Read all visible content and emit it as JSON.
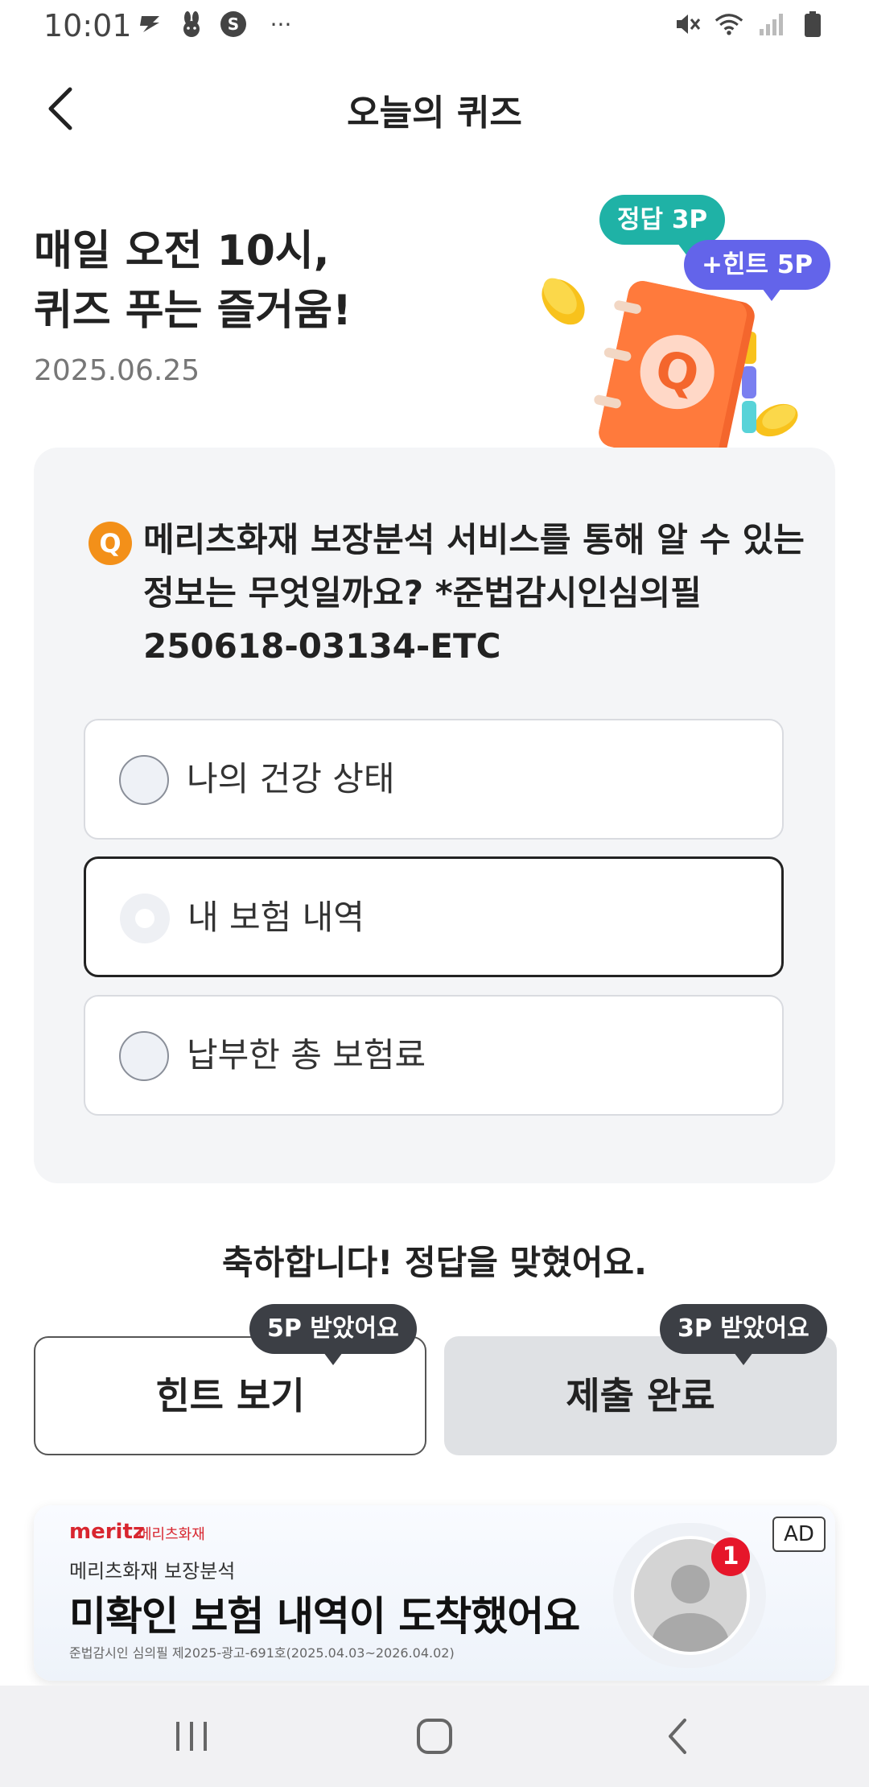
{
  "status_bar": {
    "time": "10:01",
    "left_icons": [
      "s-app-icon",
      "rabbit-app-icon",
      "s-circle-app-icon",
      "more-dots-icon"
    ],
    "more": "···",
    "right_icons": [
      "mute-icon",
      "wifi-icon",
      "signal-icon",
      "battery-icon"
    ]
  },
  "app_bar": {
    "title": "오늘의 퀴즈"
  },
  "hero": {
    "title_line1": "매일 오전 10시,",
    "title_line2": "퀴즈 푸는 즐거움!",
    "date": "2025.06.25",
    "bubble_answer": "정답 3P",
    "bubble_hint": "+힌트 5P",
    "illus_letter": "Q"
  },
  "quiz": {
    "badge": "Q",
    "question": "메리츠화재 보장분석 서비스를 통해 알 수 있는 정보는 무엇일까요? *준법감시인심의필 250618-03134-ETC",
    "options": [
      {
        "label": "나의 건강 상태",
        "selected": false
      },
      {
        "label": "내 보험 내역",
        "selected": true
      },
      {
        "label": "납부한 총 보험료",
        "selected": false
      }
    ]
  },
  "result": {
    "message": "축하합니다! 정답을 맞혔어요."
  },
  "actions": {
    "hint_label": "힌트 보기",
    "hint_tip": "5P 받았어요",
    "submit_label": "제출 완료",
    "submit_tip": "3P 받았어요"
  },
  "ad": {
    "brand": "meritz",
    "brand_kr": "메리츠화재",
    "sub": "메리츠화재 보장분석",
    "headline": "미확인 보험 내역이 도착했어요",
    "fine_print": "준법감시인 심의필 제2025-광고-691호(2025.04.03~2026.04.02)",
    "tag": "AD",
    "notification_count": "1"
  },
  "colors": {
    "accent_orange": "#f39019",
    "answer_bubble": "#1fb2a6",
    "hint_bubble": "#6364ea",
    "tip_dark": "#3c3f45",
    "brand_red": "#d8262f"
  }
}
